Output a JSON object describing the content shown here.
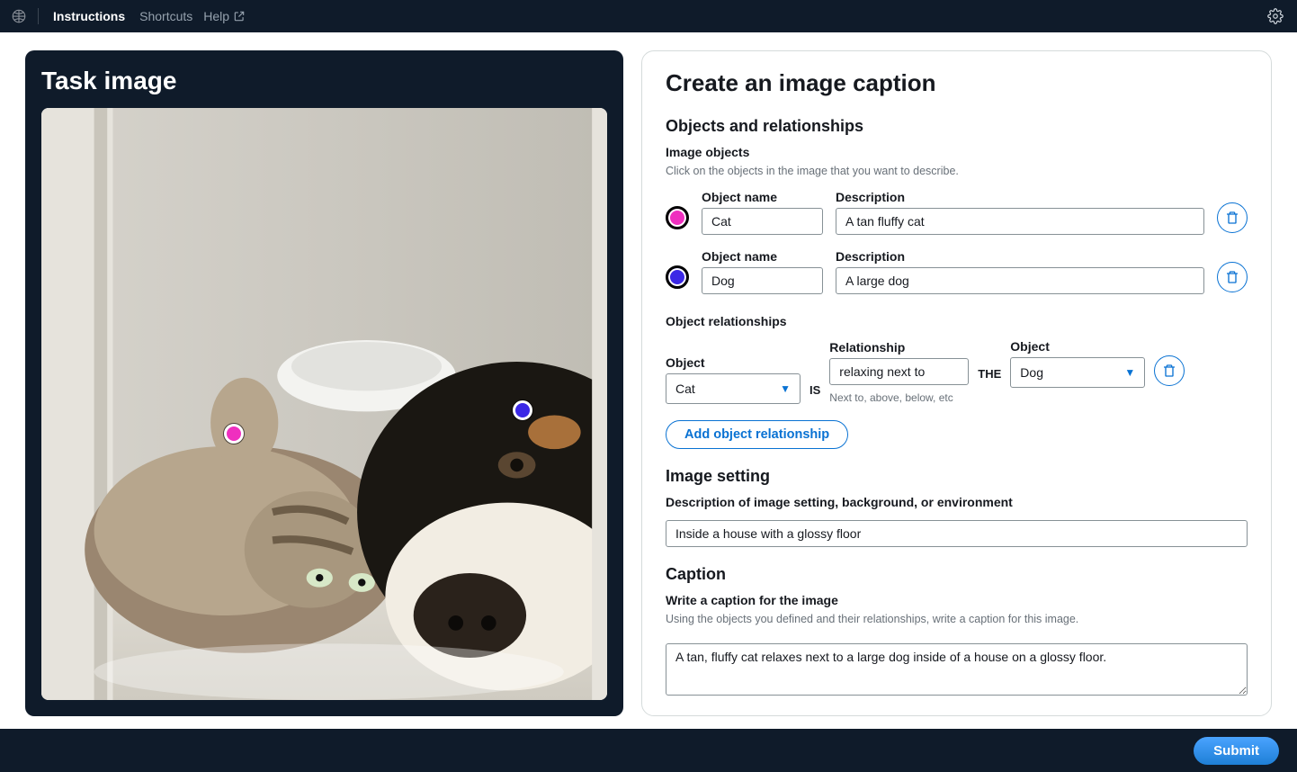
{
  "topbar": {
    "instructions": "Instructions",
    "shortcuts": "Shortcuts",
    "help": "Help"
  },
  "left": {
    "title": "Task image"
  },
  "right": {
    "title": "Create an image caption",
    "objects_heading": "Objects and relationships",
    "image_objects_label": "Image objects",
    "image_objects_helper": "Click on the objects in the image that you want to describe.",
    "object_name_label": "Object name",
    "description_label": "Description",
    "objects": [
      {
        "color": "pink",
        "name": "Cat",
        "desc": "A tan fluffy cat"
      },
      {
        "color": "blue",
        "name": "Dog",
        "desc": "A large dog"
      }
    ],
    "object_rel_heading": "Object relationships",
    "object_col": "Object",
    "relationship_col": "Relationship",
    "joint_is": "IS",
    "joint_the": "THE",
    "rel_left": "Cat",
    "rel_verb": "relaxing next to",
    "rel_right": "Dog",
    "rel_hint": "Next to, above, below, etc",
    "add_rel": "Add object relationship",
    "setting_heading": "Image setting",
    "setting_label": "Description of image setting, background, or environment",
    "setting_value": "Inside a house with a glossy floor",
    "caption_heading": "Caption",
    "caption_label": "Write a caption for the image",
    "caption_helper": "Using the objects you defined and their relationships, write a caption for this image.",
    "caption_value": "A tan, fluffy cat relaxes next to a large dog inside of a house on a glossy floor."
  },
  "footer": {
    "submit": "Submit"
  }
}
